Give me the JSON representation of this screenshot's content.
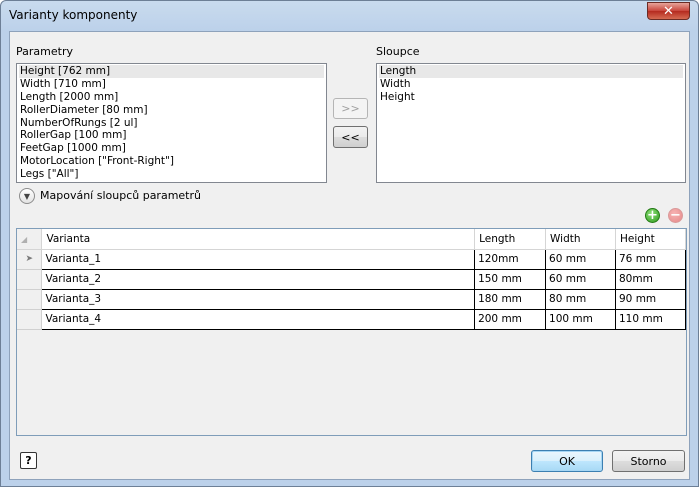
{
  "window": {
    "title": "Varianty komponenty",
    "close_glyph": "✕"
  },
  "parametry": {
    "label": "Parametry",
    "items": [
      "Height [762 mm]",
      "Width [710 mm]",
      "Length [2000 mm]",
      "RollerDiameter [80 mm]",
      "NumberOfRungs [2 ul]",
      "RollerGap [100 mm]",
      "FeetGap [1000 mm]",
      "MotorLocation [\"Front-Right\"]",
      "Legs [\"All\"]"
    ]
  },
  "move": {
    "add_label": ">>",
    "remove_label": "<<"
  },
  "sloupce": {
    "label": "Sloupce",
    "items": [
      "Length",
      "Width",
      "Height"
    ]
  },
  "mapping": {
    "label": "Mapování sloupců parametrů"
  },
  "grid": {
    "columns": [
      "Varianta",
      "Length",
      "Width",
      "Height"
    ],
    "rows": [
      [
        "Varianta_1",
        "120mm",
        "60 mm",
        "76 mm"
      ],
      [
        "Varianta_2",
        "150 mm",
        "60 mm",
        "80mm"
      ],
      [
        "Varianta_3",
        "180 mm",
        "80 mm",
        "90 mm"
      ],
      [
        "Varianta_4",
        "200 mm",
        "100 mm",
        "110 mm"
      ]
    ],
    "current_row_marker": "➤"
  },
  "footer": {
    "help_label": "?",
    "ok_label": "OK",
    "cancel_label": "Storno"
  },
  "icons": {
    "add": "add-row-icon",
    "remove": "remove-row-icon",
    "expander": "chevron-down-icon"
  }
}
